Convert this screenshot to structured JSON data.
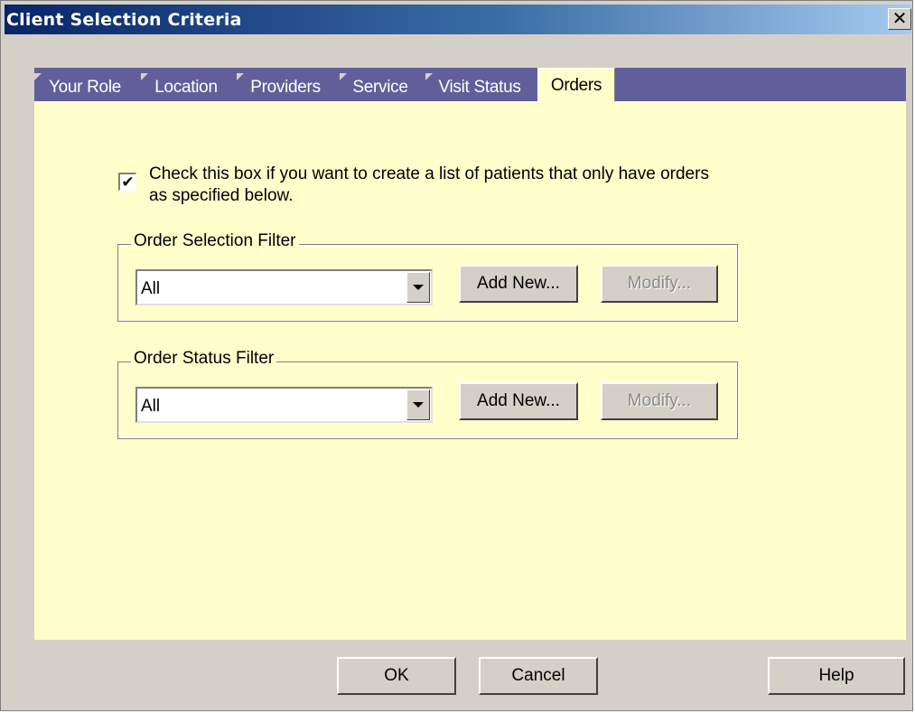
{
  "window": {
    "title": "Client Selection Criteria",
    "close_glyph": "✕"
  },
  "tabs": [
    {
      "label": "Your Role",
      "active": false
    },
    {
      "label": "Location",
      "active": false
    },
    {
      "label": "Providers",
      "active": false
    },
    {
      "label": "Service",
      "active": false
    },
    {
      "label": "Visit Status",
      "active": false
    },
    {
      "label": "Orders",
      "active": true
    }
  ],
  "orders_panel": {
    "checkbox_checked": true,
    "checkbox_mark": "✔",
    "checkbox_label": "Check this box if you want to create a list of patients that only have orders as specified below.",
    "order_selection_filter": {
      "label": "Order Selection Filter",
      "selected": "All",
      "add_new_label": "Add New...",
      "modify_label": "Modify...",
      "modify_enabled": false
    },
    "order_status_filter": {
      "label": "Order Status Filter",
      "selected": "All",
      "add_new_label": "Add New...",
      "modify_label": "Modify...",
      "modify_enabled": false
    }
  },
  "buttons": {
    "ok": "OK",
    "cancel": "Cancel",
    "help": "Help"
  },
  "colors": {
    "title_gradient_start": "#0a246a",
    "tab_strip": "#615f99",
    "panel_background": "#ffffcc",
    "dialog_face": "#d4d0c8"
  },
  "icons": {
    "close": "close-icon",
    "combo_arrow": "chevron-down-icon",
    "check": "checkmark-icon"
  }
}
